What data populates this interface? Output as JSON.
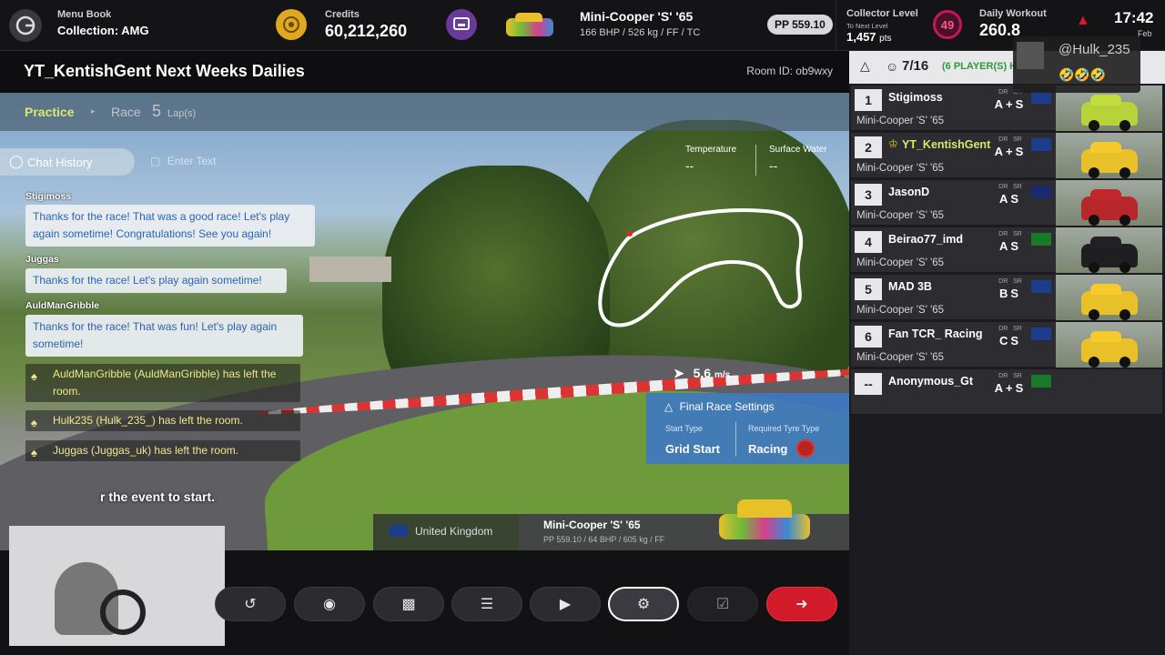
{
  "topbar": {
    "menu_book_label": "Menu Book",
    "collection": "Collection: AMG",
    "credits_label": "Credits",
    "credits": "60,212,260",
    "car_name": "Mini-Cooper 'S' '65",
    "car_specs": "166 BHP / 526 kg / FF / TC",
    "pp": "PP 559.10",
    "collector_label": "Collector Level",
    "next_level_label": "To Next Level",
    "next_level_pts": "1,457",
    "pts_unit": "pts",
    "collector_level": "49",
    "daily_workout_label": "Daily Workout",
    "daily_workout_value": "260.8",
    "clock": "17:42",
    "date_partial": "Feb"
  },
  "room": {
    "title": "YT_KentishGent Next Weeks Dailies",
    "room_id": "Room ID: ob9wxy"
  },
  "tabs": {
    "practice": "Practice",
    "race": "Race",
    "laps_num": "5",
    "laps_unit": "Lap(s)"
  },
  "chat": {
    "history_label": "Chat History",
    "input_placeholder": "Enter Text",
    "messages": [
      {
        "sender": "Stigimoss",
        "text": "Thanks for the race! That was a good race! Let's play again sometime! Congratulations! See you again!"
      },
      {
        "sender": "Juggas",
        "text": "Thanks for the race! Let's play again sometime!"
      },
      {
        "sender": "AuldManGribble",
        "text": "Thanks for the race! That was fun! Let's play again sometime!"
      }
    ],
    "system": [
      "AuldManGribble (AuldManGribble) has left the room.",
      "Hulk235 (Hulk_235_) has left the room.",
      "Juggas (Juggas_uk) has left the room."
    ],
    "wait_text": "r the event to start."
  },
  "conditions": {
    "temperature_label": "Temperature",
    "temperature_value": "--",
    "surface_water_label": "Surface Water",
    "surface_water_value": "--"
  },
  "speed": {
    "value": "5.6",
    "unit": "m/s"
  },
  "final_race": {
    "title": "Final Race Settings",
    "start_type_label": "Start Type",
    "start_type_value": "Grid Start",
    "tyre_label": "Required Tyre Type",
    "tyre_value": "Racing"
  },
  "track_info": {
    "country": "United Kingdom",
    "car_name": "Mini-Cooper 'S' '65",
    "car_specs": "PP 559.10 / 64 BHP / 605 kg / FF"
  },
  "lobby": {
    "players": "7/16",
    "players_detail": "(6 PLAYER(S) H",
    "dr_label": "DR",
    "sr_label": "SR",
    "entries": [
      {
        "pos": "1",
        "name": "Stigimoss",
        "car": "Mini-Cooper 'S' '65",
        "dr": "A+",
        "sr": "S",
        "flag": "uk",
        "color": "#b8d23a"
      },
      {
        "pos": "2",
        "name": "YT_KentishGent",
        "car": "Mini-Cooper 'S' '65",
        "dr": "A+",
        "sr": "S",
        "flag": "uk",
        "color": "#e8c02a",
        "host": true
      },
      {
        "pos": "3",
        "name": "JasonD",
        "car": "Mini-Cooper 'S' '65",
        "dr": "A",
        "sr": "S",
        "flag": "au",
        "color": "#b7262a"
      },
      {
        "pos": "4",
        "name": "Beirao77_imd",
        "car": "Mini-Cooper 'S' '65",
        "dr": "A",
        "sr": "S",
        "flag": "pt",
        "color": "#1f1f22"
      },
      {
        "pos": "5",
        "name": "MAD 3B",
        "car": "Mini-Cooper 'S' '65",
        "dr": "B",
        "sr": "S",
        "flag": "uk",
        "color": "#e8c02a"
      },
      {
        "pos": "6",
        "name": "Fan TCR_ Racing",
        "car": "Mini-Cooper 'S' '65",
        "dr": "C",
        "sr": "S",
        "flag": "uk",
        "color": "#e8c02a"
      },
      {
        "pos": "--",
        "name": "Anonymous_Gt",
        "car": "",
        "dr": "A+",
        "sr": "S",
        "flag": "pt",
        "color": ""
      }
    ]
  },
  "stream_overlay": {
    "username": "@Hulk_235",
    "emojis": "🤣🤣🤣"
  },
  "colors": {
    "accent_yellow": "#d8e86a",
    "leave_button": "#d11a2a",
    "chat_blue": "#2a64b5",
    "panel_blue": "#3d78c6"
  }
}
